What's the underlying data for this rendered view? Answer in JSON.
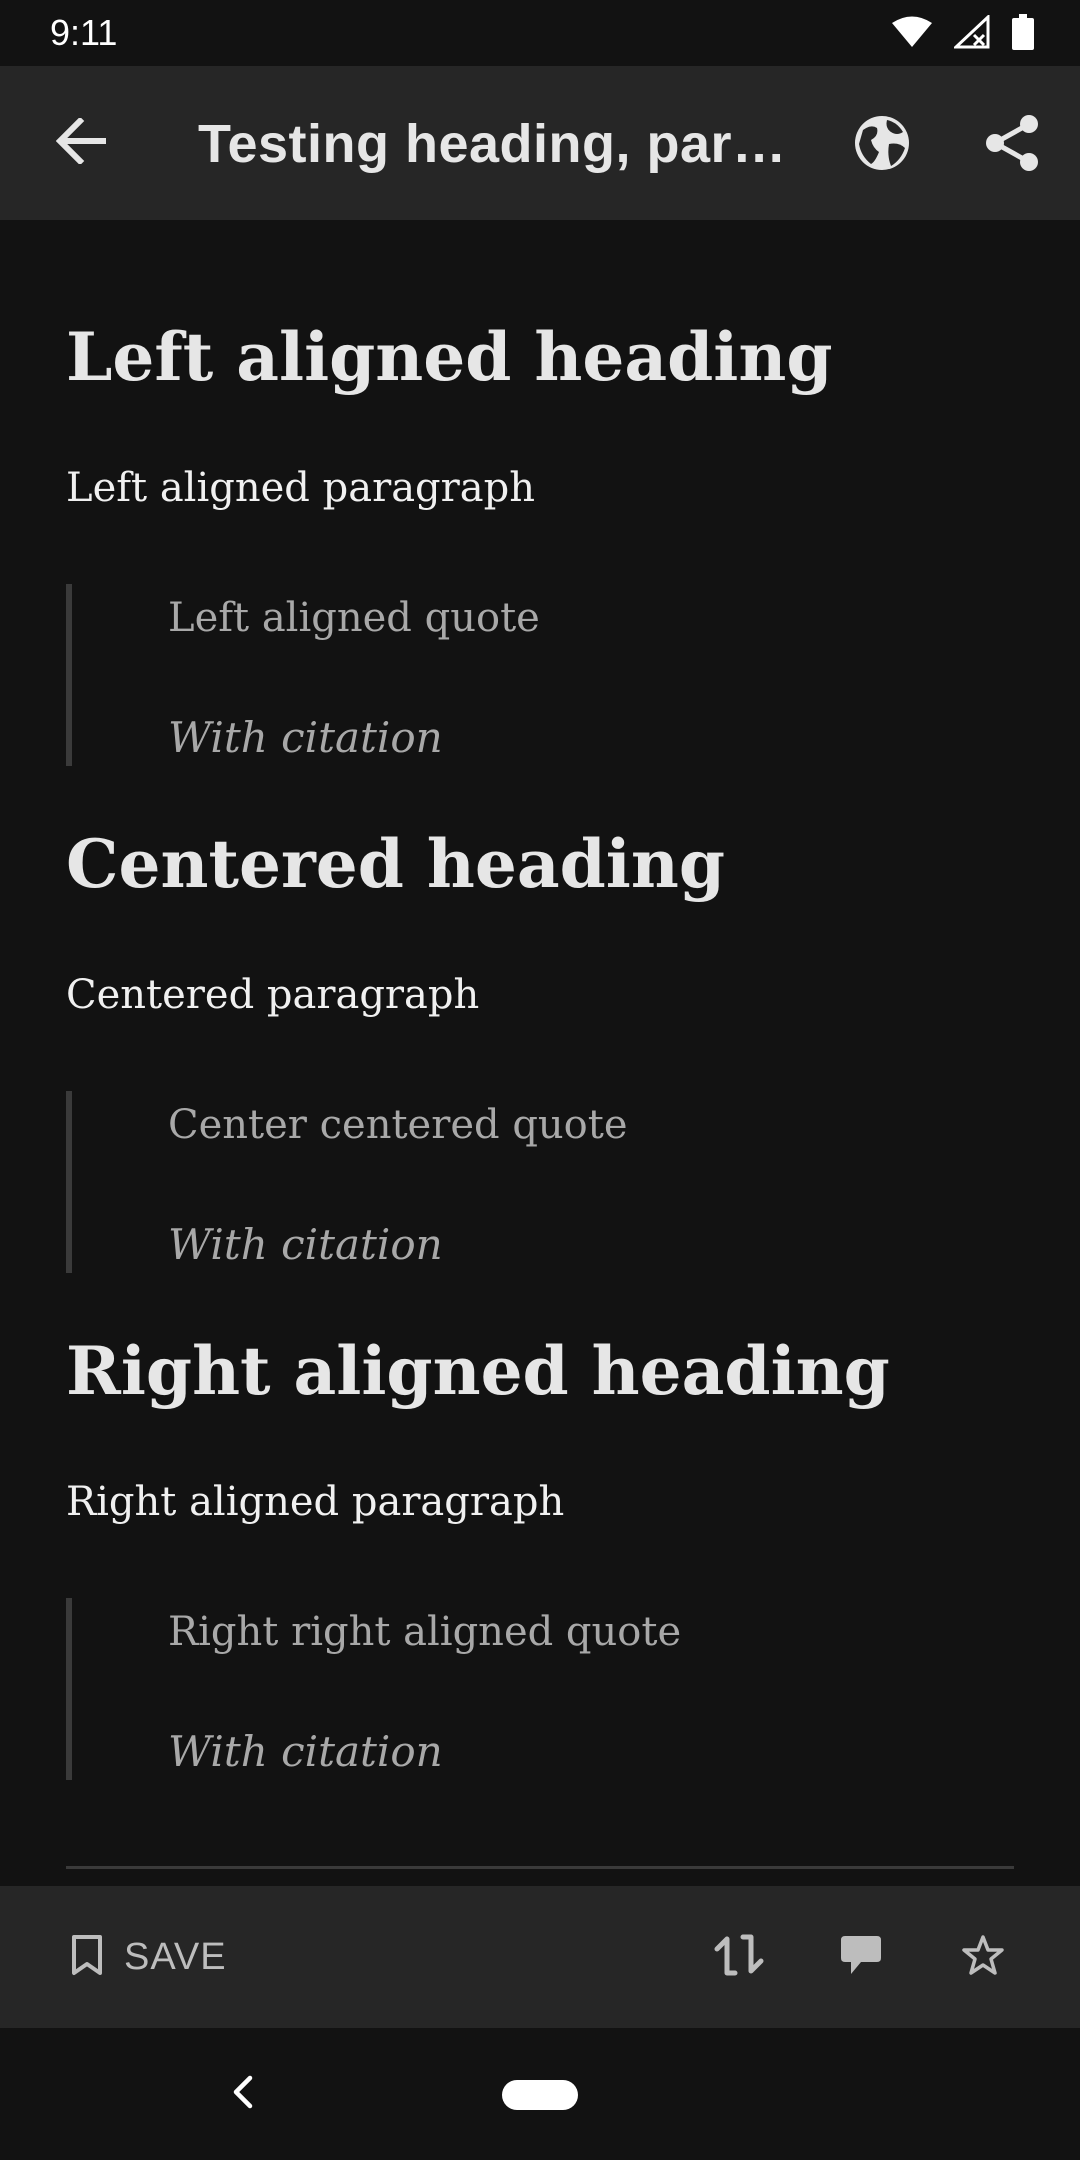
{
  "status": {
    "time": "9:11"
  },
  "appbar": {
    "title": "Testing heading, para…"
  },
  "sections": [
    {
      "heading": "Left aligned heading",
      "paragraph": "Left aligned paragraph",
      "quote": "Left aligned quote",
      "citation": "With citation"
    },
    {
      "heading": "Centered heading",
      "paragraph": "Centered paragraph",
      "quote": "Center centered quote",
      "citation": "With citation"
    },
    {
      "heading": "Right aligned heading",
      "paragraph": "Right aligned paragraph",
      "quote": "Right right aligned quote",
      "citation": "With citation"
    }
  ],
  "bottombar": {
    "save_label": "SAVE"
  },
  "icons": {
    "back": "arrow-back-icon",
    "globe": "globe-icon",
    "share": "share-icon",
    "bookmark": "bookmark-icon",
    "swap": "swap-icon",
    "comment": "comment-icon",
    "star": "star-outline-icon"
  },
  "colors": {
    "background": "#121212",
    "bar": "#262626",
    "text": "#e6e6e6",
    "muted": "#a8a8a8"
  }
}
